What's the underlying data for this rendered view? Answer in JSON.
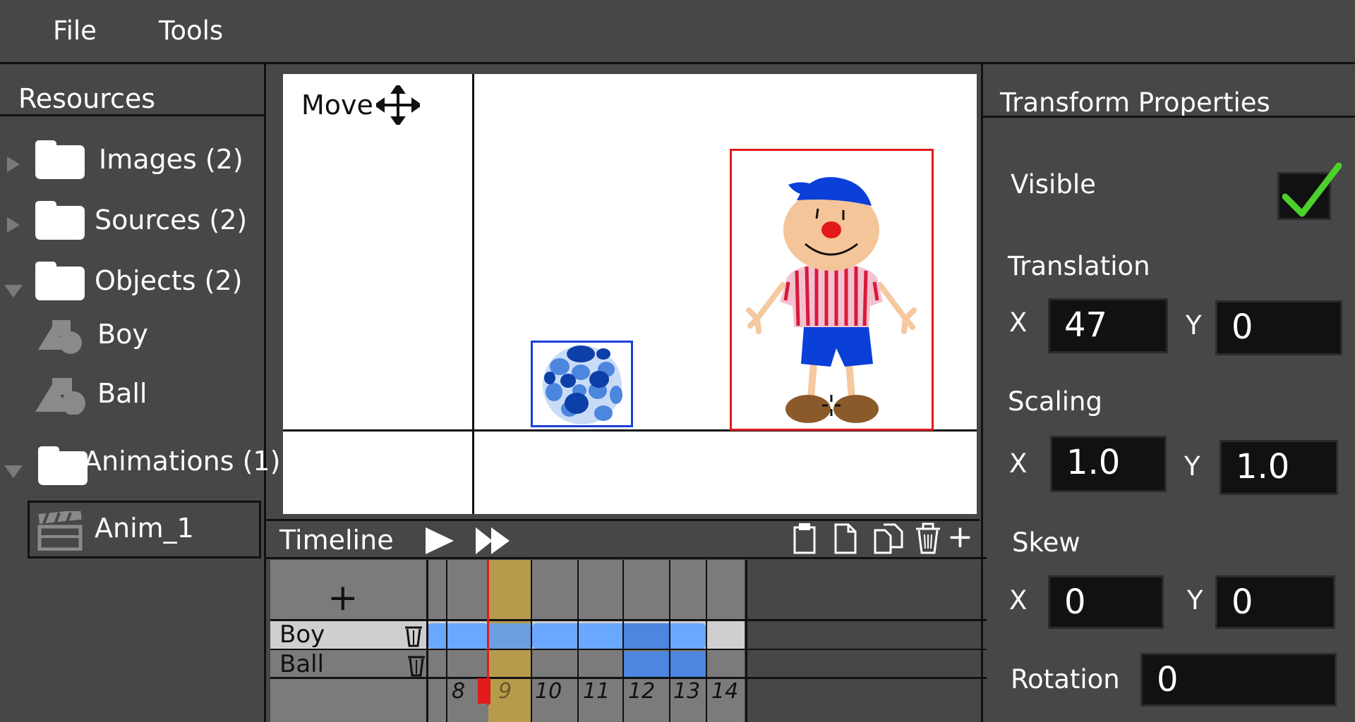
{
  "menubar": {
    "items": [
      "File",
      "Tools"
    ]
  },
  "resources": {
    "title": "Resources",
    "tree": {
      "images": "Images (2)",
      "sources": "Sources (2)",
      "objects": "Objects (2)",
      "object_items": [
        "Boy",
        "Ball"
      ],
      "animations": "Animations (1)",
      "anim_items": [
        "Anim_1"
      ]
    }
  },
  "canvas": {
    "tool_label": "Move",
    "tool_icon": "move-arrows-icon",
    "objects": [
      "boy-sprite",
      "ball-sprite"
    ],
    "selection_colors": {
      "boy": "#e21a1a",
      "ball": "#1a3fd6"
    }
  },
  "timeline": {
    "title": "Timeline",
    "add_symbol": "+",
    "toolbar_add": "+",
    "tracks": [
      {
        "name": "Boy"
      },
      {
        "name": "Ball"
      }
    ],
    "frames": [
      "8",
      "9",
      "10",
      "11",
      "12",
      "13",
      "14"
    ],
    "current_frame": "9",
    "colors": {
      "key": "#6aa7ff",
      "key_dark": "#4c86de",
      "highlight": "#b79b4c",
      "playhead": "#e21a1a"
    }
  },
  "properties": {
    "title": "Transform Properties",
    "visible_label": "Visible",
    "visible": true,
    "translation": {
      "label": "Translation",
      "x_label": "X",
      "y_label": "Y",
      "x": "47",
      "y": "0"
    },
    "scaling": {
      "label": "Scaling",
      "x_label": "X",
      "y_label": "Y",
      "x": "1.0",
      "y": "1.0"
    },
    "skew": {
      "label": "Skew",
      "x_label": "X",
      "y_label": "Y",
      "x": "0",
      "y": "0"
    },
    "rotation": {
      "label": "Rotation",
      "value": "0"
    },
    "check_color": "#4cd12a"
  }
}
